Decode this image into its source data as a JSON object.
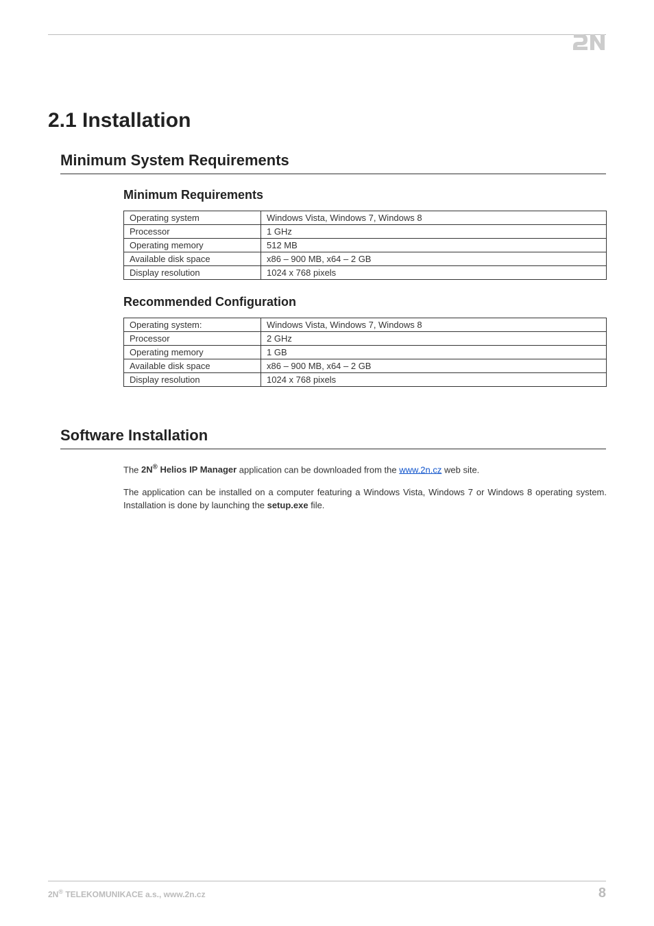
{
  "page": {
    "title": "2.1 Installation",
    "number": "8"
  },
  "sections": {
    "minreq": {
      "heading": "Minimum System Requirements",
      "sub_min": {
        "heading": "Minimum Requirements",
        "rows": {
          "os_label": "Operating system",
          "os_value": "Windows Vista, Windows 7, Windows 8",
          "proc_label": "Processor",
          "proc_value": "1 GHz",
          "mem_label": "Operating memory",
          "mem_value": "512 MB",
          "disk_label": "Available disk space",
          "disk_value": "x86 – 900 MB, x64 – 2 GB",
          "res_label": "Display resolution",
          "res_value": "1024 x 768 pixels"
        }
      },
      "sub_rec": {
        "heading": "Recommended Configuration",
        "rows": {
          "os_label": "Operating system:",
          "os_value": "Windows Vista, Windows 7, Windows 8",
          "proc_label": "Processor",
          "proc_value": "2 GHz",
          "mem_label": "Operating memory",
          "mem_value": "1 GB",
          "disk_label": "Available disk space",
          "disk_value": "x86 – 900 MB, x64 – 2 GB",
          "res_label": "Display resolution",
          "res_value": "1024 x 768 pixels"
        }
      }
    },
    "install": {
      "heading": "Software Installation",
      "para1_pre": "The ",
      "para1_bold_prefix": "2N",
      "para1_bold_sup": "®",
      "para1_bold_rest": " Helios IP Manager",
      "para1_mid": " application can be downloaded from the ",
      "para1_link_text": "www.2n.cz",
      "para1_post": " web site.",
      "para2_pre": "The application can be installed on a computer featuring a Windows Vista, Windows 7 or Windows 8 operating system.  Installation is done by launching the ",
      "para2_bold": "setup.exe",
      "para2_post": " file."
    }
  },
  "footer": {
    "left_prefix": "2N",
    "left_sup": "®",
    "left_rest": " TELEKOMUNIKACE a.s., www.2n.cz"
  }
}
